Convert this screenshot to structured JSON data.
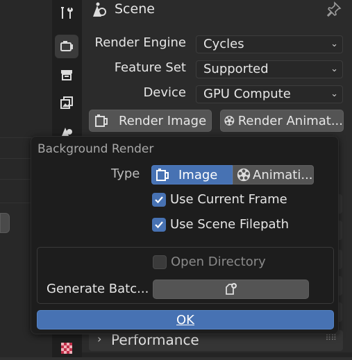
{
  "header": {
    "title": "Scene"
  },
  "render": {
    "engine_label": "Render Engine",
    "engine_value": "Cycles",
    "feature_label": "Feature Set",
    "feature_value": "Supported",
    "device_label": "Device",
    "device_value": "GPU Compute",
    "render_image_label": "Render Image",
    "render_animation_label": "Render Animat..."
  },
  "popup": {
    "title": "Background Render",
    "type_label": "Type",
    "type_options": [
      "Image",
      "Animati..."
    ],
    "type_selected": "Image",
    "use_current_frame": {
      "label": "Use Current Frame",
      "checked": true
    },
    "use_scene_filepath": {
      "label": "Use Scene Filepath",
      "checked": true
    },
    "open_directory": {
      "label": "Open Directory",
      "checked": false,
      "enabled": false
    },
    "generate_batch_label": "Generate Batc...",
    "ok_label": "OK"
  },
  "panels": {
    "performance_label": "Performance"
  },
  "colors": {
    "accent": "#4772b3",
    "popup_bg": "#1d1d1d",
    "panel_bg": "#2b2b2b"
  }
}
